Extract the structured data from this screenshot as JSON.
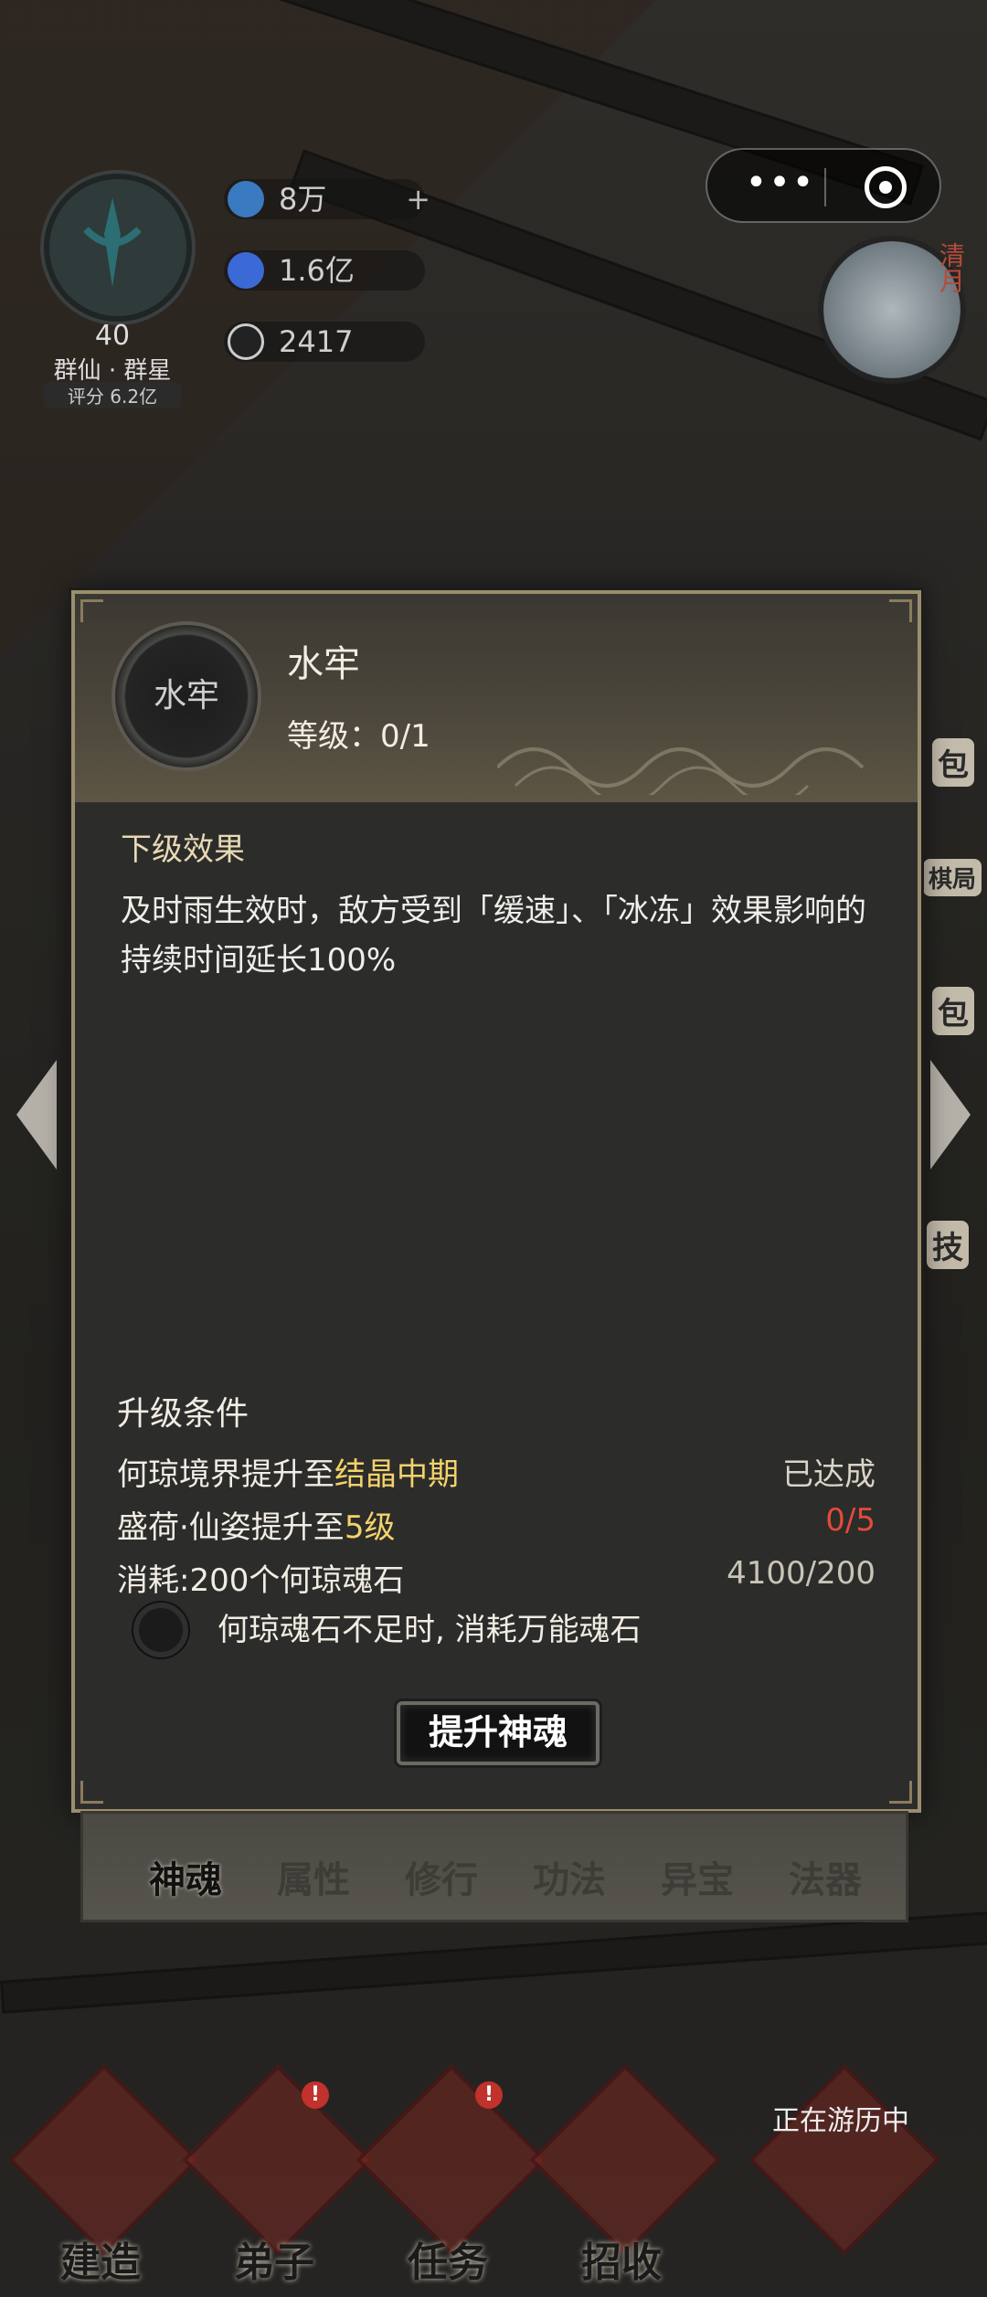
{
  "top_bar": {
    "player_level": "40",
    "player_group": "群仙 · 群星",
    "player_score": "评分 6.2亿",
    "resources": [
      {
        "icon": "spirit-stone-icon",
        "value": "8万",
        "has_plus": true,
        "plus": "+"
      },
      {
        "icon": "essence-orb-icon",
        "value": "1.6亿"
      },
      {
        "icon": "taiji-icon",
        "value": "2417"
      }
    ],
    "capsule": {
      "more": "•••"
    },
    "clock_label": "清月"
  },
  "modal": {
    "skill_icon_text": "水牢",
    "skill_name": "水牢",
    "skill_level": "等级：0/1",
    "next_effect_title": "下级效果",
    "next_effect_text": "及时雨生效时，敌方受到「缓速」、「冰冻」效果影响的持续时间延长100%",
    "conditions_title": "升级条件",
    "conditions": [
      {
        "prefix": "何琼境界提升至",
        "highlight": "结晶中期",
        "suffix": "",
        "status": "已达成",
        "status_type": "ok"
      },
      {
        "prefix": "盛荷·仙姿提升至",
        "highlight": "5级",
        "suffix": "",
        "status": "0/5",
        "status_type": "bad"
      },
      {
        "prefix": "消耗:200个何琼魂石",
        "highlight": "",
        "suffix": "",
        "status": "4100/200",
        "status_type": "neutral"
      }
    ],
    "toggle_label": "何琼魂石不足时, 消耗万能魂石",
    "upgrade_button": "提升神魂"
  },
  "tabs": [
    {
      "label": "神魂",
      "active": true
    },
    {
      "label": "属性",
      "active": false
    },
    {
      "label": "修行",
      "active": false
    },
    {
      "label": "功法",
      "active": false
    },
    {
      "label": "异宝",
      "active": false
    },
    {
      "label": "法器",
      "active": false
    }
  ],
  "side_tags": {
    "right_1": "包",
    "right_2": "棋局",
    "right_3": "包",
    "right_4": "技"
  },
  "bottom_nav": [
    {
      "label": "建造",
      "badge": false
    },
    {
      "label": "弟子",
      "badge": true
    },
    {
      "label": "任务",
      "badge": true
    },
    {
      "label": "招收",
      "badge": false
    }
  ],
  "travel_label": "正在游历中",
  "colors": {
    "highlight": "#f3d36b",
    "bad": "#e24b3a",
    "modal_border": "#9b8e6d"
  }
}
